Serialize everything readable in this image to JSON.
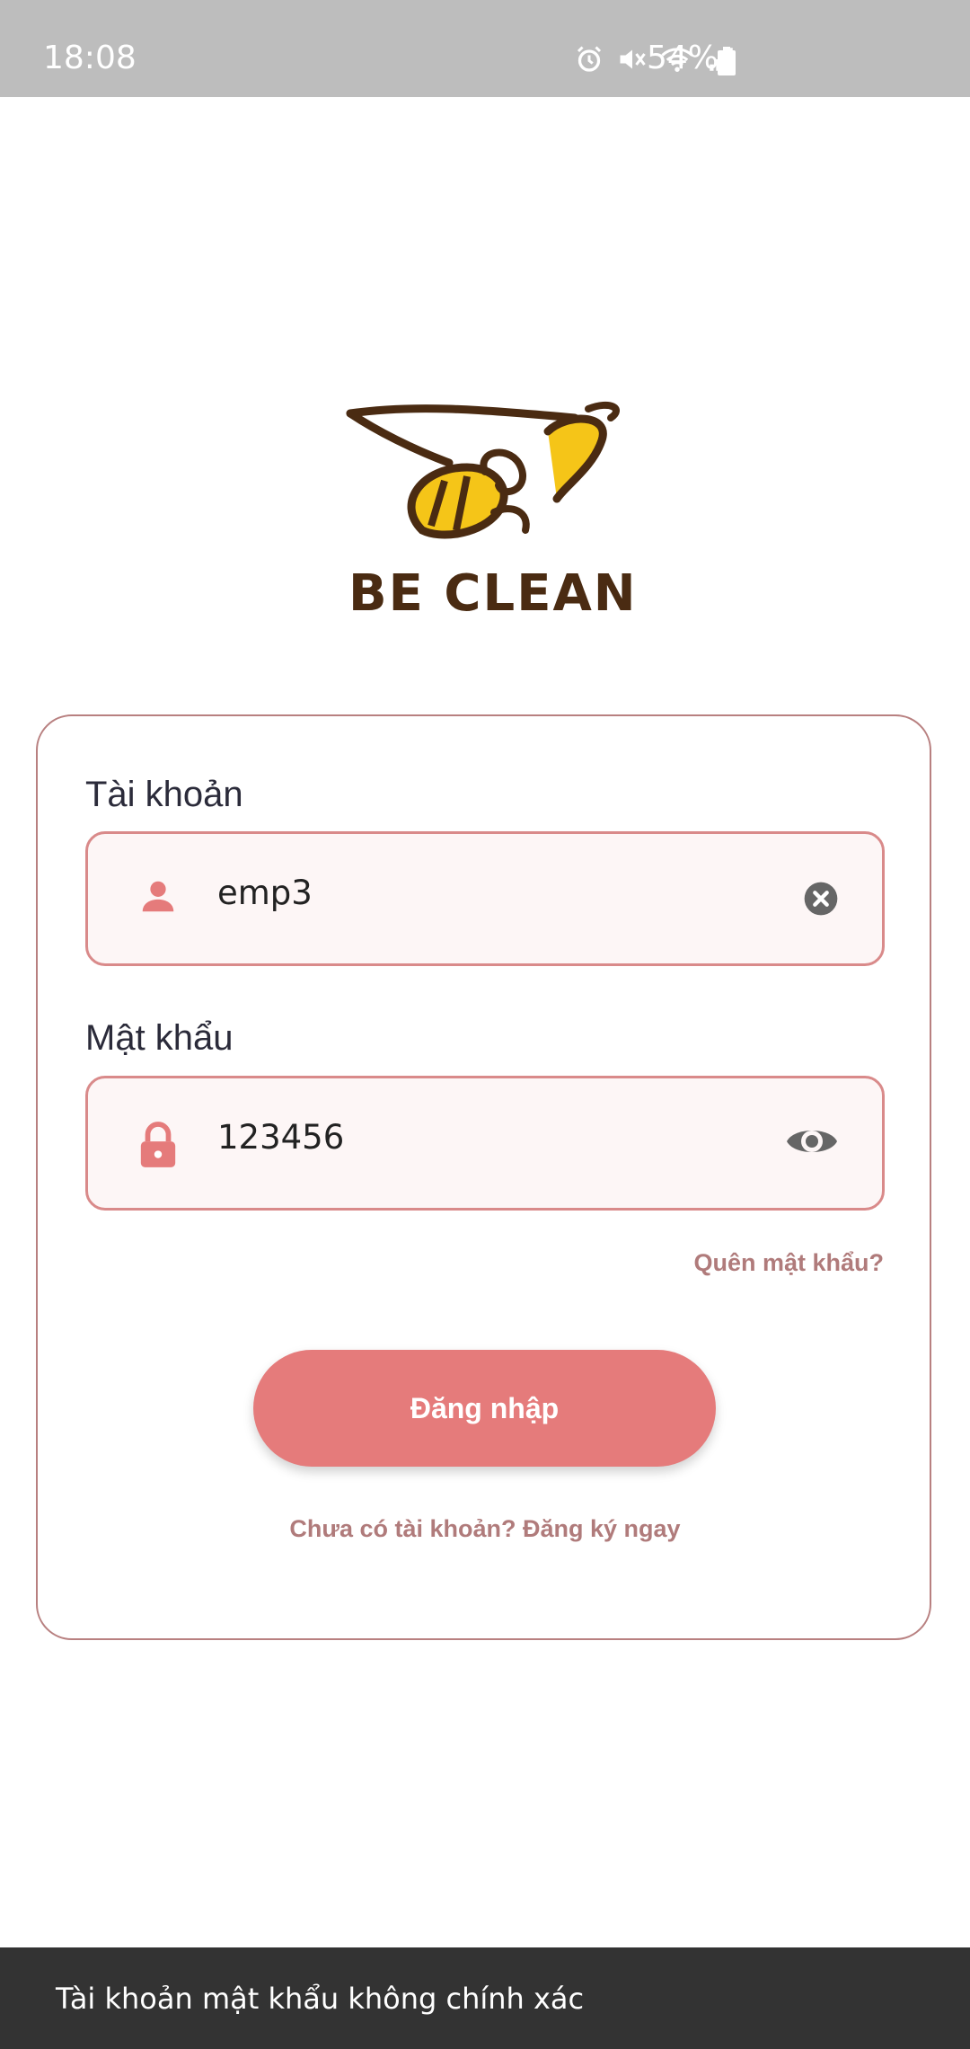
{
  "status_bar": {
    "time": "18:08",
    "battery": "54%",
    "icons": [
      "alarm-icon",
      "mute-icon",
      "wifi-icon",
      "signal-icon",
      "battery-icon"
    ]
  },
  "logo": {
    "text": "BE CLEAN"
  },
  "login_form": {
    "username_label": "Tài khoản",
    "username_value": "emp3",
    "password_label": "Mật khẩu",
    "password_value": "123456",
    "forgot_password": "Quên mật khẩu?",
    "login_button": "Đăng nhập",
    "signup_link": "Chưa có tài khoản? Đăng ký ngay"
  },
  "snackbar": {
    "message": "Tài khoản mật khẩu không chính xác"
  },
  "colors": {
    "accent": "#e57b7b",
    "field_border": "#d98a8a",
    "field_bg": "#fdf6f6",
    "link": "#b07b7b",
    "logo_brown": "#4a2b12",
    "logo_yellow": "#f5c518"
  }
}
